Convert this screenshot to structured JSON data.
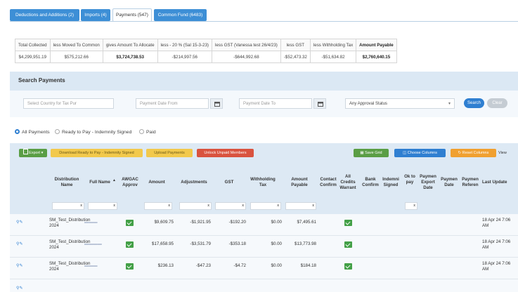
{
  "tabs": [
    {
      "label": "Deductions and Additions (2)"
    },
    {
      "label": "Imports (4)"
    },
    {
      "label": "Payments (547)"
    },
    {
      "label": "Common Fund (6483)"
    }
  ],
  "summary": {
    "headers": [
      "Total Collected",
      "less Moved To Common",
      "gives Amount To Allocate",
      "less - 20 % (Sal 15-3-23)",
      "less GST (Vanessa test 26/4/23)",
      "less GST",
      "less Withholding Tax",
      "Amount Payable"
    ],
    "values": [
      "$4,299,951.19",
      "$575,212.66",
      "$3,724,738.53",
      "-$214,997.56",
      "-$644,992.68",
      "-$52,473.32",
      "-$51,634.82",
      "$2,760,640.15"
    ]
  },
  "search": {
    "title": "Search Payments",
    "country_placeholder": "Select Country for Tax Pur",
    "date_from_placeholder": "Payment Date From",
    "date_to_placeholder": "Payment Date To",
    "approval_status": "Any Approval Status",
    "search_label": "Search",
    "clear_label": "Clear"
  },
  "filters": {
    "all": "All Payments",
    "ready": "Ready to Pay - Indemnity Signed",
    "paid": "Paid"
  },
  "toolbar": {
    "export": "Export",
    "download": "Download Ready to Pay - Indemnity Signed",
    "upload": "Upload Payments",
    "unlock": "Unlock Unpaid Members",
    "save_grid": "Save Grid",
    "choose_columns": "Choose Columns",
    "reset_columns": "Reset Columns",
    "view": "View"
  },
  "columns": [
    "Distribution Name",
    "Full Name",
    "AWGAC Approv",
    "Amount",
    "Adjustments",
    "GST",
    "Withholding Tax",
    "Amount Payable",
    "Contact Confirm",
    "All Credits Warrant",
    "Bank Confirm",
    "Indemni Signed",
    "Ok to pay",
    "Paymen Export Date",
    "Paymen Date",
    "Paymen Referen",
    "Last Update"
  ],
  "rows": [
    {
      "distribution": "SM_Test_Distribution 2024",
      "amount": "$9,609.75",
      "adjustments": "-$1,921.95",
      "gst": "-$192.20",
      "withholding": "$0.00",
      "payable": "$7,495.61",
      "last_update": "18 Apr 24 7:06 AM"
    },
    {
      "distribution": "SM_Test_Distribution 2024",
      "amount": "$17,658.95",
      "adjustments": "-$3,531.79",
      "gst": "-$353.18",
      "withholding": "$0.00",
      "payable": "$13,773.98",
      "last_update": "18 Apr 24 7:06 AM"
    },
    {
      "distribution": "SM_Test_Distribution 2024",
      "amount": "$236.13",
      "adjustments": "-$47.23",
      "gst": "-$4.72",
      "withholding": "$0.00",
      "payable": "$184.18",
      "last_update": "18 Apr 24 7:06 AM"
    }
  ]
}
